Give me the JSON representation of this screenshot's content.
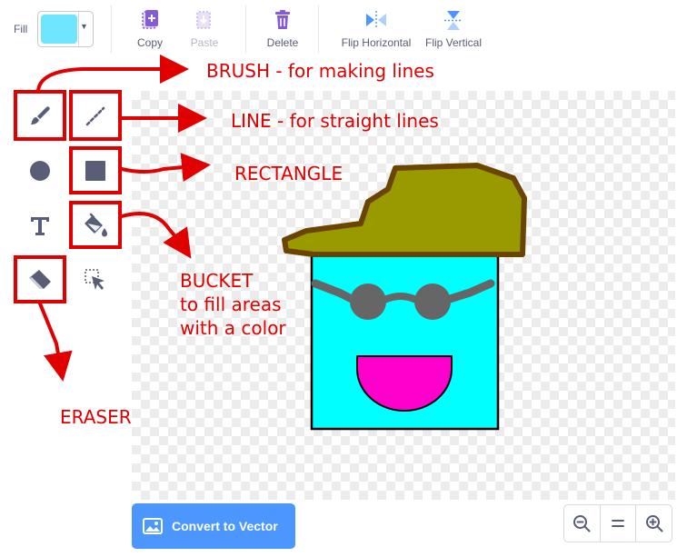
{
  "toolbar": {
    "fill_label": "Fill",
    "fill_color": "#6fe5ff",
    "copy_label": "Copy",
    "paste_label": "Paste",
    "delete_label": "Delete",
    "flip_horizontal_label": "Flip Horizontal",
    "flip_vertical_label": "Flip Vertical"
  },
  "tools": [
    {
      "id": "brush",
      "icon": "brush-icon",
      "highlighted": true
    },
    {
      "id": "line",
      "icon": "line-icon",
      "highlighted": true
    },
    {
      "id": "circle",
      "icon": "circle-icon",
      "highlighted": false
    },
    {
      "id": "rectangle",
      "icon": "rectangle-icon",
      "highlighted": true
    },
    {
      "id": "text",
      "icon": "text-icon",
      "highlighted": false
    },
    {
      "id": "fill",
      "icon": "bucket-icon",
      "highlighted": true
    },
    {
      "id": "eraser",
      "icon": "eraser-icon",
      "highlighted": true
    },
    {
      "id": "select",
      "icon": "select-icon",
      "highlighted": false
    }
  ],
  "annotations": {
    "brush": "BRUSH - for making lines",
    "line": "LINE - for straight lines",
    "rectangle": "RECTANGLE",
    "bucket_line1": "BUCKET",
    "bucket_line2": "to fill areas",
    "bucket_line3": "with a color",
    "eraser": "ERASER"
  },
  "canvas": {
    "face_color": "#00ffff",
    "hat_color": "#999900",
    "hat_outline_color": "#6b4400",
    "glasses_color": "#666666",
    "mouth_color": "#ff00cc"
  },
  "bottom": {
    "convert_label": "Convert to Vector"
  },
  "colors": {
    "accent": "#4c97ff",
    "annotation": "#e00000",
    "icon": "#575e75"
  }
}
